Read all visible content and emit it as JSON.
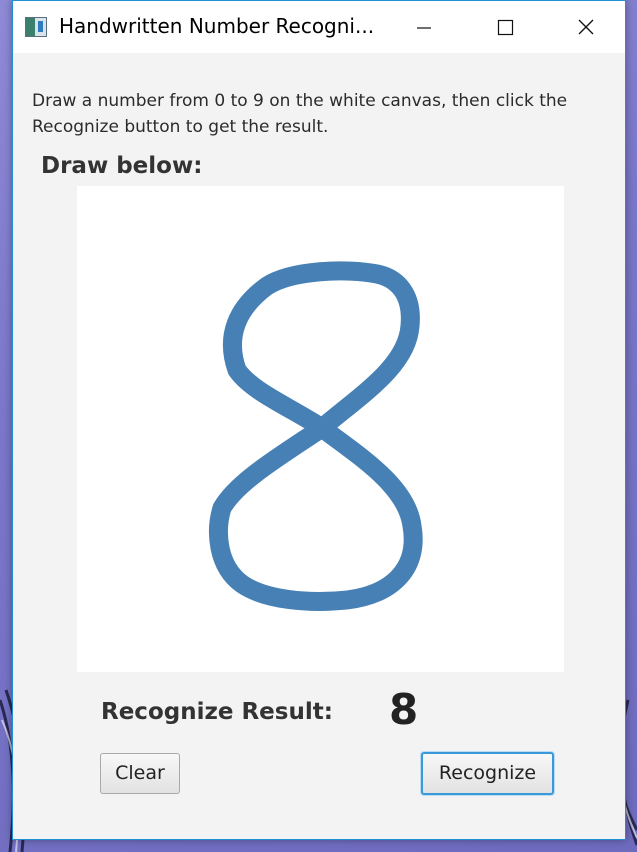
{
  "window": {
    "title": "Handwritten Number Recogni...",
    "accent_color": "#1e91d6",
    "controls": [
      {
        "name": "minimize",
        "icon": "minimize-icon"
      },
      {
        "name": "maximize",
        "icon": "maximize-icon"
      },
      {
        "name": "close",
        "icon": "close-icon"
      }
    ]
  },
  "main": {
    "instructions": "Draw a number from 0 to 9 on the white canvas, then click the Recognize button to get the result.",
    "draw_label": "Draw below:",
    "canvas": {
      "background": "#ffffff",
      "stroke_color": "#4680b5",
      "drawn_digit": "8"
    },
    "result_label": "Recognize Result:",
    "result_value": "8"
  },
  "buttons": {
    "clear_label": "Clear",
    "recognize_label": "Recognize"
  }
}
